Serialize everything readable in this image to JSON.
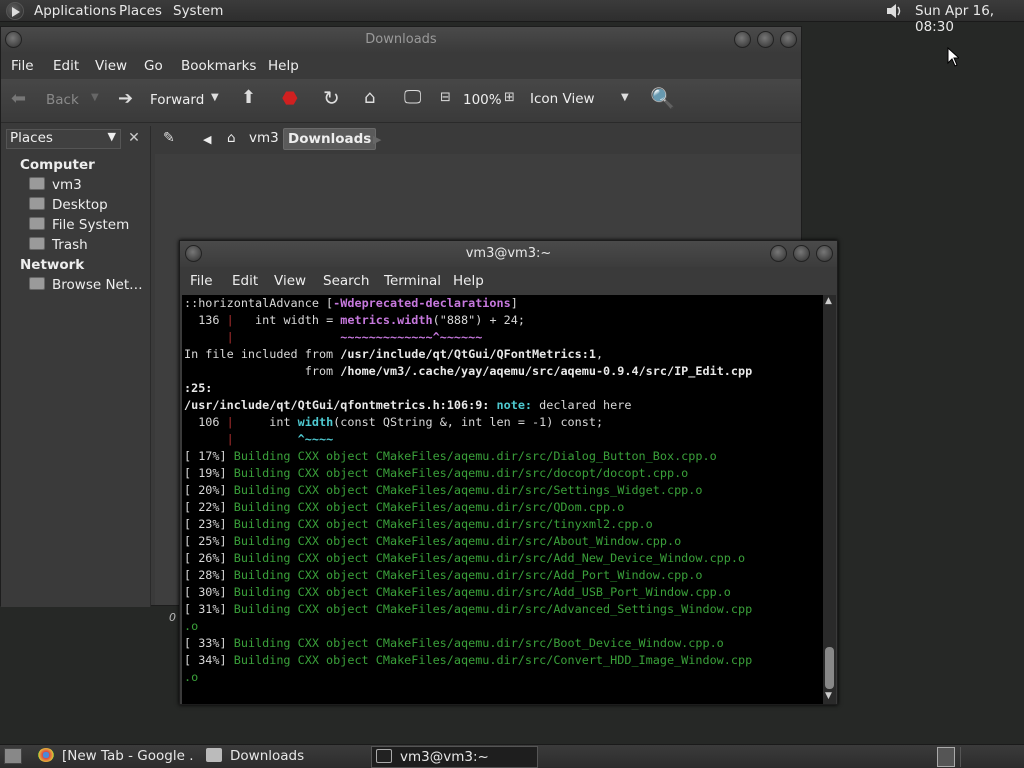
{
  "top_panel": {
    "menus": [
      "Applications",
      "Places",
      "System"
    ],
    "clock": "Sun Apr 16, 08:30"
  },
  "file_manager": {
    "title": "Downloads",
    "menus": [
      "File",
      "Edit",
      "View",
      "Go",
      "Bookmarks",
      "Help"
    ],
    "toolbar": {
      "back": "Back",
      "forward": "Forward",
      "zoom": "100%",
      "view_mode": "Icon View"
    },
    "sidebar": {
      "selector": "Places",
      "computer_heading": "Computer",
      "items": [
        "vm3",
        "Desktop",
        "File System",
        "Trash"
      ],
      "network_heading": "Network",
      "network_items": [
        "Browse Net…"
      ]
    },
    "path": [
      "vm3",
      "Downloads"
    ],
    "status_zero": "0"
  },
  "terminal": {
    "title": "vm3@vm3:~",
    "menus": [
      "File",
      "Edit",
      "View",
      "Search",
      "Terminal",
      "Help"
    ],
    "lines": [
      [
        {
          "t": "::horizontalAdvance [",
          "c": "c-white"
        },
        {
          "t": "-Wdeprecated-declarations",
          "c": "c-magenta"
        },
        {
          "t": "]",
          "c": "c-white"
        }
      ],
      [
        {
          "t": "  136 ",
          "c": "c-white"
        },
        {
          "t": "|",
          "c": "c-redbar"
        },
        {
          "t": "   int width = ",
          "c": "c-white"
        },
        {
          "t": "metrics.width",
          "c": "c-magenta"
        },
        {
          "t": "(\"888\") + 24;",
          "c": "c-white"
        }
      ],
      [
        {
          "t": "      ",
          "c": "c-white"
        },
        {
          "t": "|",
          "c": "c-redbar"
        },
        {
          "t": "               ",
          "c": "c-white"
        },
        {
          "t": "~~~~~~~~~~~~~^~~~~~~",
          "c": "c-magenta"
        }
      ],
      [
        {
          "t": "In file included from ",
          "c": "c-white"
        },
        {
          "t": "/usr/include/qt/QtGui/QFontMetrics:1",
          "c": "c-bold"
        },
        {
          "t": ",",
          "c": "c-white"
        }
      ],
      [
        {
          "t": "                 from ",
          "c": "c-white"
        },
        {
          "t": "/home/vm3/.cache/yay/aqemu/src/aqemu-0.9.4/src/IP_Edit.cpp",
          "c": "c-bold"
        }
      ],
      [
        {
          "t": ":25:",
          "c": "c-bold"
        }
      ],
      [
        {
          "t": "/usr/include/qt/QtGui/qfontmetrics.h:106:9: ",
          "c": "c-bold"
        },
        {
          "t": "note: ",
          "c": "c-cyan"
        },
        {
          "t": "declared here",
          "c": "c-white"
        }
      ],
      [
        {
          "t": "  106 ",
          "c": "c-white"
        },
        {
          "t": "|",
          "c": "c-redbar"
        },
        {
          "t": "     int ",
          "c": "c-white"
        },
        {
          "t": "width",
          "c": "c-cyan"
        },
        {
          "t": "(const QString &, int len = -1) const;",
          "c": "c-white"
        }
      ],
      [
        {
          "t": "      ",
          "c": "c-white"
        },
        {
          "t": "|",
          "c": "c-redbar"
        },
        {
          "t": "         ",
          "c": "c-white"
        },
        {
          "t": "^~~~~",
          "c": "c-cyan"
        }
      ],
      [
        {
          "t": "[ 17%] ",
          "c": "c-white"
        },
        {
          "t": "Building CXX object CMakeFiles/aqemu.dir/src/Dialog_Button_Box.cpp.o",
          "c": "c-green"
        }
      ],
      [
        {
          "t": "[ 19%] ",
          "c": "c-white"
        },
        {
          "t": "Building CXX object CMakeFiles/aqemu.dir/src/docopt/docopt.cpp.o",
          "c": "c-green"
        }
      ],
      [
        {
          "t": "[ 20%] ",
          "c": "c-white"
        },
        {
          "t": "Building CXX object CMakeFiles/aqemu.dir/src/Settings_Widget.cpp.o",
          "c": "c-green"
        }
      ],
      [
        {
          "t": "[ 22%] ",
          "c": "c-white"
        },
        {
          "t": "Building CXX object CMakeFiles/aqemu.dir/src/QDom.cpp.o",
          "c": "c-green"
        }
      ],
      [
        {
          "t": "[ 23%] ",
          "c": "c-white"
        },
        {
          "t": "Building CXX object CMakeFiles/aqemu.dir/src/tinyxml2.cpp.o",
          "c": "c-green"
        }
      ],
      [
        {
          "t": "[ 25%] ",
          "c": "c-white"
        },
        {
          "t": "Building CXX object CMakeFiles/aqemu.dir/src/About_Window.cpp.o",
          "c": "c-green"
        }
      ],
      [
        {
          "t": "[ 26%] ",
          "c": "c-white"
        },
        {
          "t": "Building CXX object CMakeFiles/aqemu.dir/src/Add_New_Device_Window.cpp.o",
          "c": "c-green"
        }
      ],
      [
        {
          "t": "[ 28%] ",
          "c": "c-white"
        },
        {
          "t": "Building CXX object CMakeFiles/aqemu.dir/src/Add_Port_Window.cpp.o",
          "c": "c-green"
        }
      ],
      [
        {
          "t": "[ 30%] ",
          "c": "c-white"
        },
        {
          "t": "Building CXX object CMakeFiles/aqemu.dir/src/Add_USB_Port_Window.cpp.o",
          "c": "c-green"
        }
      ],
      [
        {
          "t": "[ 31%] ",
          "c": "c-white"
        },
        {
          "t": "Building CXX object CMakeFiles/aqemu.dir/src/Advanced_Settings_Window.cpp",
          "c": "c-green"
        }
      ],
      [
        {
          "t": ".o",
          "c": "c-green"
        }
      ],
      [
        {
          "t": "[ 33%] ",
          "c": "c-white"
        },
        {
          "t": "Building CXX object CMakeFiles/aqemu.dir/src/Boot_Device_Window.cpp.o",
          "c": "c-green"
        }
      ],
      [
        {
          "t": "[ 34%] ",
          "c": "c-white"
        },
        {
          "t": "Building CXX object CMakeFiles/aqemu.dir/src/Convert_HDD_Image_Window.cpp",
          "c": "c-green"
        }
      ],
      [
        {
          "t": ".o",
          "c": "c-green"
        }
      ]
    ]
  },
  "bottom_panel": {
    "tasks": [
      "[New Tab - Google ...",
      "Downloads",
      "vm3@vm3:~"
    ]
  }
}
